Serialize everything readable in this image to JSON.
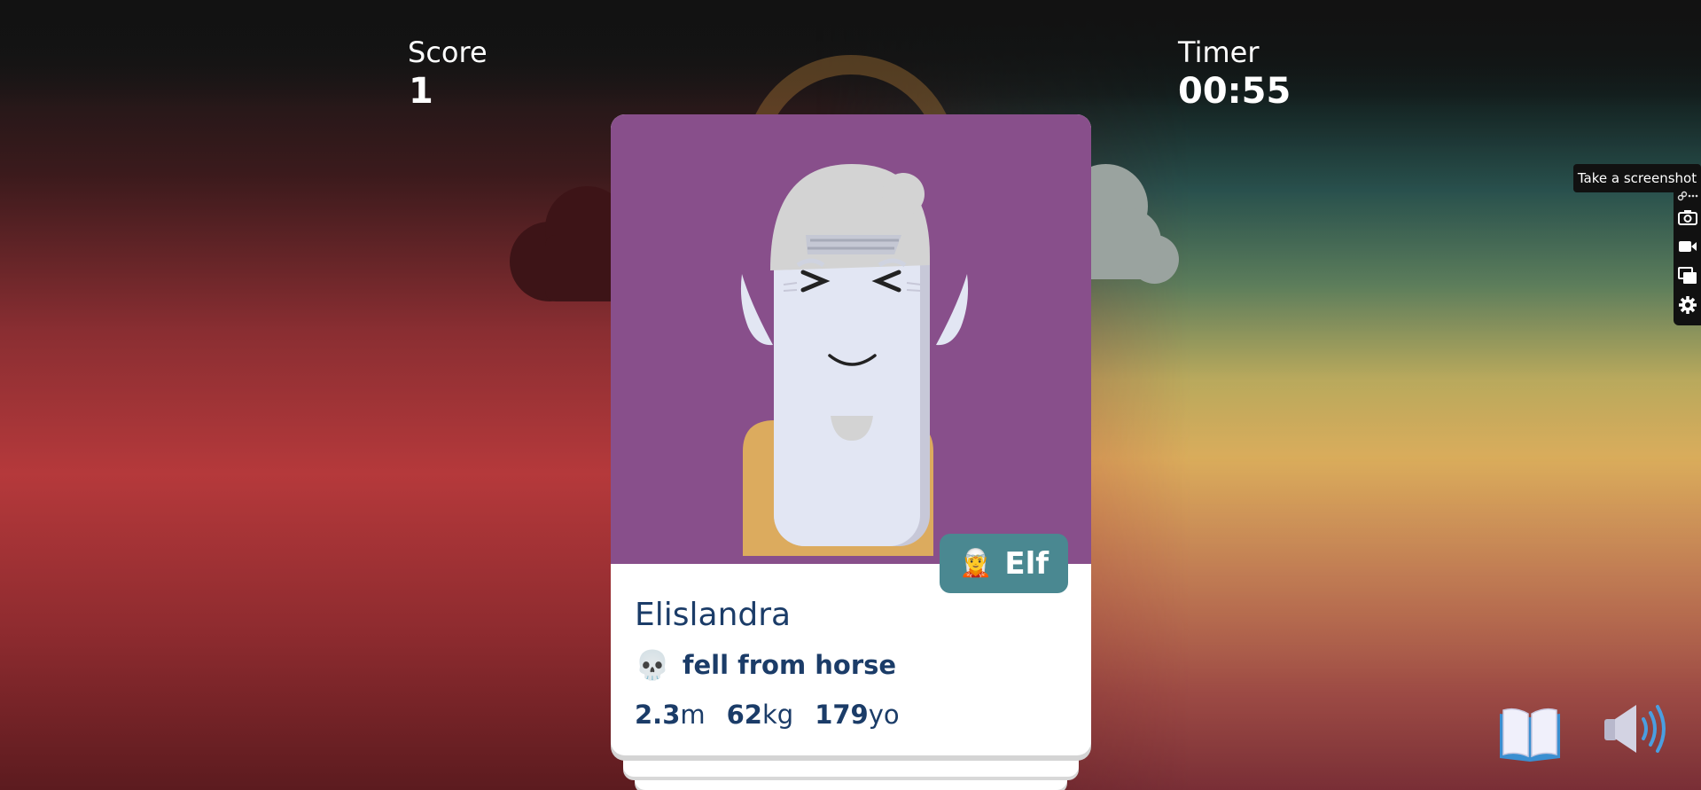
{
  "hud": {
    "score_label": "Score",
    "score_value": "1",
    "timer_label": "Timer",
    "timer_value": "00:55"
  },
  "card": {
    "name": "Elislandra",
    "species": {
      "label": "Elf",
      "icon": "elf-emoji",
      "emoji": "🧝"
    },
    "death": {
      "icon": "skull-emoji",
      "emoji": "💀",
      "text": "fell from horse"
    },
    "stats": [
      {
        "value": "2.3",
        "unit": "m"
      },
      {
        "value": "62",
        "unit": "kg"
      },
      {
        "value": "179",
        "unit": "yo"
      }
    ],
    "colors": {
      "portrait_bg": "#884f8b",
      "badge_bg": "#4a8891",
      "text": "#1b3c68",
      "skin": "#e2e6f3",
      "hair": "#d3d3d3",
      "shirt": "#dcab5e"
    }
  },
  "screenshot_toolbar": {
    "tooltip": "Take a screenshot",
    "tools": [
      "link-icon",
      "more-icon",
      "camera-icon",
      "video-icon",
      "windows-icon",
      "gear-icon"
    ]
  },
  "corner_buttons": {
    "rules_icon": "open-book-icon",
    "sound_icon": "speaker-icon"
  }
}
